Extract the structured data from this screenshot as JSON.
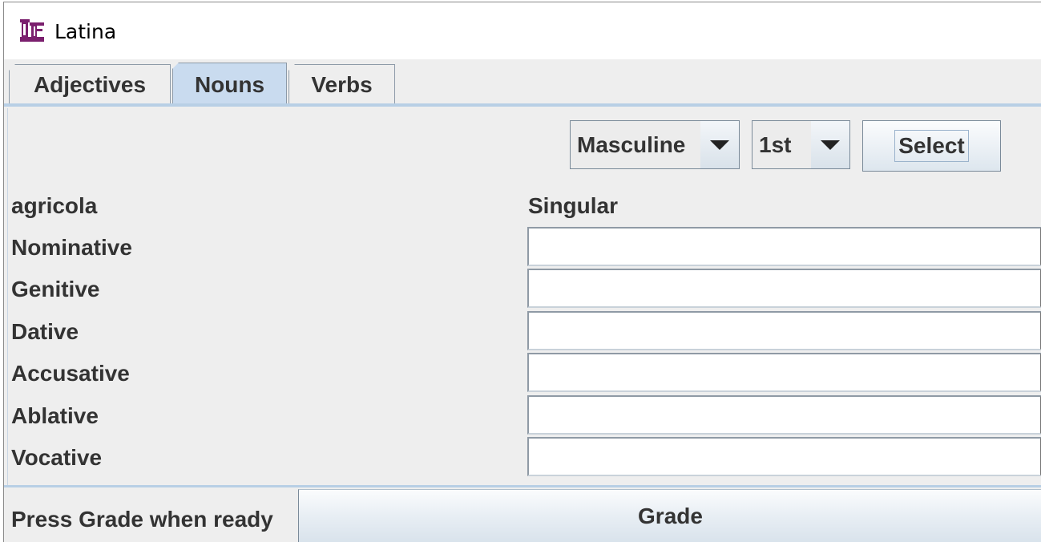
{
  "window": {
    "title": "Latina",
    "icon": "latina-app-icon"
  },
  "tabs": [
    {
      "label": "Adjectives",
      "selected": false
    },
    {
      "label": "Nouns",
      "selected": true
    },
    {
      "label": "Verbs",
      "selected": false
    }
  ],
  "controls": {
    "gender_select": {
      "value": "Masculine",
      "icon": "chevron-down-icon"
    },
    "declension_select": {
      "value": "1st",
      "icon": "chevron-down-icon"
    },
    "select_label": "Select"
  },
  "noun": "agricola",
  "column_header": "Singular",
  "cases": [
    {
      "label": "Nominative",
      "value": ""
    },
    {
      "label": "Genitive",
      "value": ""
    },
    {
      "label": "Dative",
      "value": ""
    },
    {
      "label": "Accusative",
      "value": ""
    },
    {
      "label": "Ablative",
      "value": ""
    },
    {
      "label": "Vocative",
      "value": ""
    }
  ],
  "footer": {
    "status": "Press Grade when ready",
    "grade_label": "Grade"
  },
  "colors": {
    "selected_tab": "#c9dbef",
    "icon": "#7b1f6e",
    "text": "#333333"
  }
}
